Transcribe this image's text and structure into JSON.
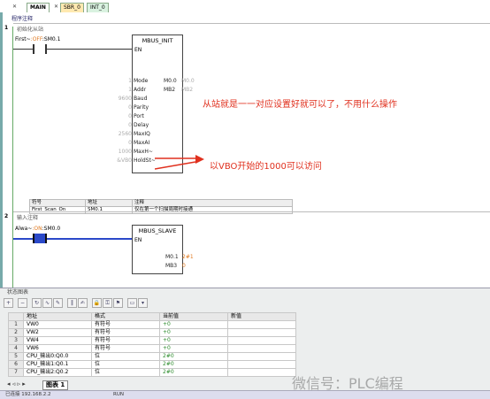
{
  "tabs": [
    {
      "label": "MAIN",
      "active": true
    },
    {
      "label": "SBR_0",
      "active": false
    },
    {
      "label": "INT_0",
      "active": false
    }
  ],
  "program_comment": "程序注释",
  "networks": [
    {
      "number": "1",
      "comment": "初始化从站",
      "contact": {
        "label": "First~:OFF:SM0.1",
        "name": "First~",
        "state": "OFF",
        "address": "SM0.1"
      },
      "block": {
        "title": "MBUS_INIT",
        "en": "EN",
        "inputs": [
          {
            "value": "1",
            "pin": "Mode"
          },
          {
            "value": "1",
            "pin": "Addr"
          },
          {
            "value": "9600",
            "pin": "Baud"
          },
          {
            "value": "0",
            "pin": "Parity"
          },
          {
            "value": "0",
            "pin": "Port"
          },
          {
            "value": "0",
            "pin": "Delay"
          },
          {
            "value": "2560",
            "pin": "MaxIQ"
          },
          {
            "value": "0",
            "pin": "MaxAI"
          },
          {
            "value": "1000",
            "pin": "MaxH~"
          },
          {
            "value": "&VB0",
            "pin": "HoldSt~"
          }
        ],
        "outputs": [
          {
            "pin": "Done",
            "address": "M0.0",
            "value": "M0.0"
          },
          {
            "pin": "Error",
            "address": "MB2",
            "value": "MB2"
          }
        ]
      },
      "annotations": [
        "从站就是一一对应设置好就可以了，不用什么操作",
        "以VBO开始的1000可以访问"
      ],
      "symbol_table": {
        "headers": [
          "符号",
          "地址",
          "注释"
        ],
        "row": [
          "First_Scan_On",
          "SM0.1",
          "仅在第一个扫描周期时接通"
        ]
      }
    },
    {
      "number": "2",
      "comment": "输入注释",
      "contact": {
        "label": "Alwa~:ON:SM0.0",
        "name": "Alwa~",
        "state": "ON",
        "address": "SM0.0"
      },
      "block": {
        "title": "MBUS_SLAVE",
        "en": "EN",
        "outputs": [
          {
            "pin": "Done",
            "address": "M0.1",
            "value": "2#1"
          },
          {
            "pin": "Error",
            "address": "MB3",
            "value": "0"
          }
        ]
      }
    }
  ],
  "status_chart": {
    "title": "状态图表",
    "columns": [
      "",
      "地址",
      "格式",
      "当前值",
      "新值"
    ],
    "rows": [
      {
        "n": "1",
        "address": "VW0",
        "format": "有符号",
        "current": "+0",
        "new": ""
      },
      {
        "n": "2",
        "address": "VW2",
        "format": "有符号",
        "current": "+0",
        "new": ""
      },
      {
        "n": "3",
        "address": "VW4",
        "format": "有符号",
        "current": "+0",
        "new": ""
      },
      {
        "n": "4",
        "address": "VW6",
        "format": "有符号",
        "current": "+0",
        "new": ""
      },
      {
        "n": "5",
        "address": "CPU_输出0:Q0.0",
        "format": "位",
        "current": "2#0",
        "new": ""
      },
      {
        "n": "6",
        "address": "CPU_输出1:Q0.1",
        "format": "位",
        "current": "2#0",
        "new": ""
      },
      {
        "n": "7",
        "address": "CPU_输出2:Q0.2",
        "format": "位",
        "current": "2#0",
        "new": ""
      }
    ],
    "sheet_tab": "图表 1"
  },
  "statusbar": {
    "connection": "已连接 192.168.2.2",
    "mode": "RUN"
  },
  "watermark": "微信号：PLC编程",
  "colors": {
    "annotation": "#e0301e",
    "current_value": "#2a8a2a",
    "contact_on": "#2b49c9"
  }
}
